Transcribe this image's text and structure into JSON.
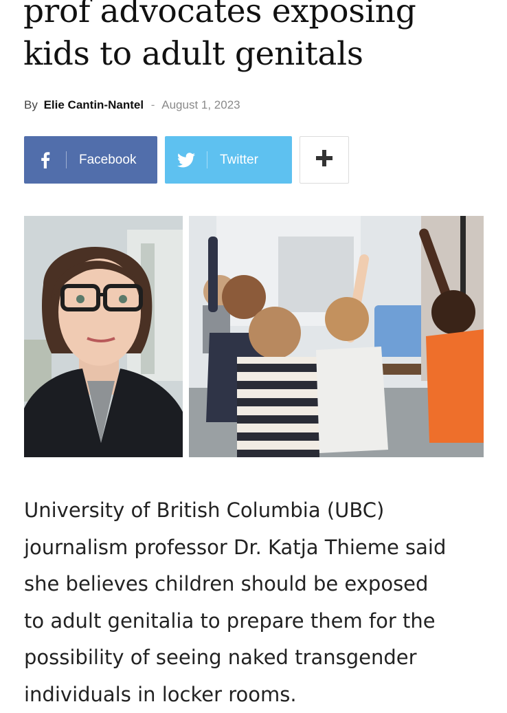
{
  "article": {
    "headline_lines": [
      "prof advocates exposing",
      "kids to adult genitals"
    ],
    "byline": {
      "by": "By",
      "author": "Elie Cantin-Nantel",
      "separator": "-",
      "date": "August 1, 2023"
    },
    "share": {
      "facebook_label": "Facebook",
      "twitter_label": "Twitter",
      "more_label": "+",
      "colors": {
        "facebook": "#516eab",
        "twitter": "#5ec1f0"
      },
      "icons": [
        "facebook-icon",
        "twitter-icon",
        "plus-icon"
      ]
    },
    "images": [
      {
        "name": "portrait-photo",
        "subject": "woman with glasses"
      },
      {
        "name": "classroom-photo",
        "subject": "children raising hands in classroom"
      }
    ],
    "body_lines": [
      "University of British Columbia (UBC)",
      "journalism professor Dr. Katja Thieme said",
      "she believes children should be exposed",
      "to adult genitalia to prepare them for the",
      "possibility of seeing naked transgender",
      "individuals in locker rooms."
    ]
  }
}
